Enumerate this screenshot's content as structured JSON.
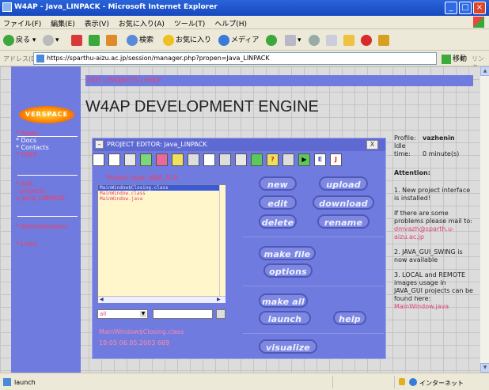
{
  "window": {
    "title": "W4AP - Java_LINPACK - Microsoft Internet Explorer"
  },
  "menu": [
    "ファイル(F)",
    "編集(E)",
    "表示(V)",
    "お気に入り(A)",
    "ツール(T)",
    "ヘルプ(H)"
  ],
  "toolbar": {
    "back": "戻る",
    "search": "検索",
    "favorites": "お気に入り",
    "media": "メディア"
  },
  "address": {
    "label": "アドレス(D)",
    "url": "https://sparthu-aizu.ac.jp/session/manager.php?propen=Java_LINPACK",
    "go": "移動",
    "links": "リンク"
  },
  "page": {
    "logo_text": "VERSPACE",
    "top_links": "EXIT | PROJECTS | HELP",
    "title": "W4AP DEVELOPMENT ENGINE",
    "nav_group1": [
      "* News",
      "* Docs",
      "* Contacts",
      "* HELP"
    ],
    "nav_group2": [
      "* Exit",
      "- projects",
      "\\- Java_LINPACK"
    ],
    "nav_admin": "* Administration",
    "nav_links": "* Links"
  },
  "editor": {
    "title": "PROJECT EDITOR: Java_LINPACK",
    "close": "X",
    "min": "–",
    "project_type": "Project type: JAVA_GUI",
    "files": [
      "MainWindow$Closing.class",
      "MainWindow.class",
      "MainWindow.java"
    ],
    "filter": "all",
    "selected_file": "MainWindow$Closing.class",
    "file_info": "19:05 06.05.2003    669",
    "buttons": {
      "new": "new",
      "upload": "upload",
      "edit": "edit",
      "download": "download",
      "delete": "delete",
      "rename": "rename",
      "make_file": "make file",
      "options": "options",
      "make_all": "make all",
      "launch": "launch",
      "help": "help",
      "visualize": "visualize"
    },
    "icon_letters": [
      "E",
      "J"
    ]
  },
  "profile": {
    "profile_label": "Profile:",
    "profile_value": "vazhenin",
    "idle_label": "Idle time:",
    "idle_value": "0 minute(s)"
  },
  "attention": {
    "heading": "Attention:",
    "p1": "1. New project interface is installed!",
    "p2": "If there are some problems please mail to:",
    "p2_link": "dmvazh@sparth.u-aizu.ac.jp",
    "p3": "2. JAVA_GUI_SWING is now available",
    "p4": "3. LOCAL and REMOTE images usage in JAVA_GUI projects can be found here:",
    "p4_link": "MainWindow.java"
  },
  "status": {
    "text": "launch",
    "zone": "インターネット"
  }
}
